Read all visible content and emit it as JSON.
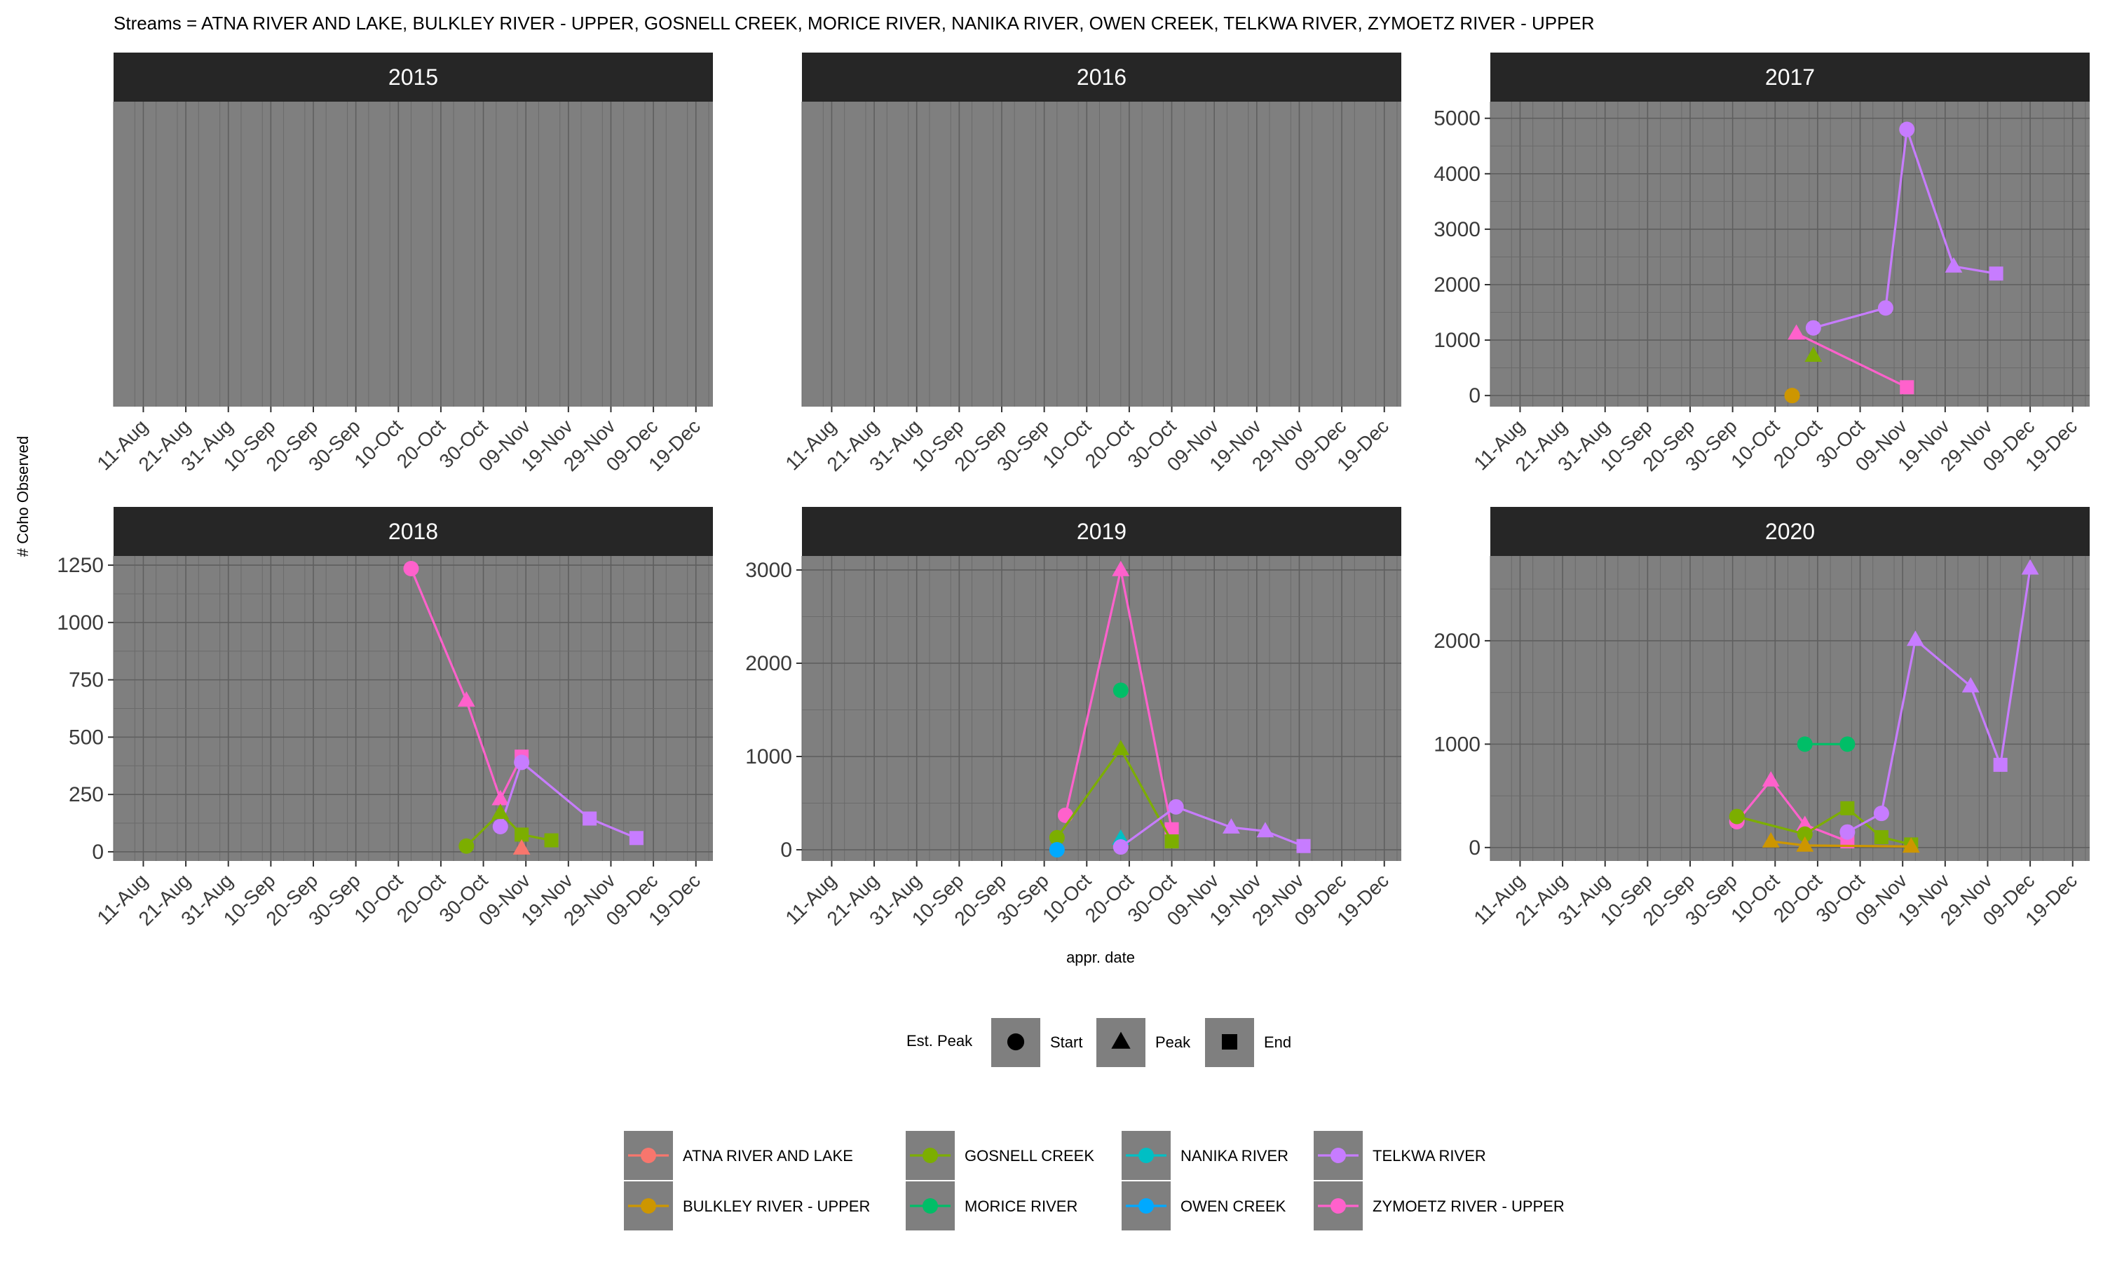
{
  "header": "Streams = ATNA RIVER AND LAKE, BULKLEY RIVER - UPPER, GOSNELL CREEK, MORICE RIVER, NANIKA RIVER, OWEN CREEK, TELKWA RIVER, ZYMOETZ RIVER - UPPER",
  "colors": {
    "ATNA RIVER AND LAKE": "#F8766D",
    "BULKLEY RIVER - UPPER": "#CD9600",
    "GOSNELL CREEK": "#7CAE00",
    "MORICE RIVER": "#00BE67",
    "NANIKA RIVER": "#00BFC4",
    "OWEN CREEK": "#00A9FF",
    "TELKWA RIVER": "#C77CFF",
    "ZYMOETZ RIVER - UPPER": "#FF61CC",
    "panel_bg": "#7F7F7F",
    "strip_bg": "#262626"
  },
  "chart_data": {
    "type": "scatter",
    "ylabel": "# Coho Observed",
    "xlabel": "appr. date",
    "x_ticks": [
      "11-Aug",
      "21-Aug",
      "31-Aug",
      "10-Sep",
      "20-Sep",
      "30-Sep",
      "10-Oct",
      "20-Oct",
      "30-Oct",
      "09-Nov",
      "19-Nov",
      "29-Nov",
      "09-Dec",
      "19-Dec"
    ],
    "xlim": [
      "04-Aug",
      "23-Dec"
    ],
    "legend_shape": {
      "title": "Est. Peak",
      "items": [
        "Start",
        "Peak",
        "End"
      ]
    },
    "legend_color": {
      "items": [
        "ATNA RIVER AND LAKE",
        "BULKLEY RIVER - UPPER",
        "GOSNELL CREEK",
        "MORICE RIVER",
        "NANIKA RIVER",
        "OWEN CREEK",
        "TELKWA RIVER",
        "ZYMOETZ RIVER - UPPER"
      ]
    },
    "panels": [
      {
        "title": "2015",
        "ylim": null,
        "yticks": [],
        "series": []
      },
      {
        "title": "2016",
        "ylim": null,
        "yticks": [],
        "series": []
      },
      {
        "title": "2017",
        "ylim": [
          -200,
          5300
        ],
        "yticks": [
          0,
          1000,
          2000,
          3000,
          4000,
          5000
        ],
        "series": [
          {
            "name": "TELKWA RIVER",
            "points": [
              [
                "19-Oct",
                1220,
                "Start"
              ],
              [
                "05-Nov",
                1580,
                "Start"
              ],
              [
                "10-Nov",
                4800,
                "Start"
              ],
              [
                "21-Nov",
                2330,
                "Peak"
              ],
              [
                "01-Dec",
                2200,
                "End"
              ]
            ]
          },
          {
            "name": "ZYMOETZ RIVER - UPPER",
            "points": [
              [
                "15-Oct",
                1120,
                "Peak"
              ],
              [
                "10-Nov",
                150,
                "End"
              ]
            ]
          },
          {
            "name": "GOSNELL CREEK",
            "points": [
              [
                "19-Oct",
                720,
                "Peak"
              ]
            ]
          },
          {
            "name": "BULKLEY RIVER - UPPER",
            "points": [
              [
                "14-Oct",
                0,
                "Start"
              ]
            ]
          }
        ]
      },
      {
        "title": "2018",
        "ylim": [
          -40,
          1290
        ],
        "yticks": [
          0,
          250,
          500,
          750,
          1000,
          1250
        ],
        "series": [
          {
            "name": "ZYMOETZ RIVER - UPPER",
            "points": [
              [
                "13-Oct",
                1235,
                "Start"
              ],
              [
                "26-Oct",
                660,
                "Peak"
              ],
              [
                "03-Nov",
                230,
                "Peak"
              ],
              [
                "08-Nov",
                415,
                "End"
              ]
            ]
          },
          {
            "name": "TELKWA RIVER",
            "points": [
              [
                "03-Nov",
                110,
                "Start"
              ],
              [
                "08-Nov",
                390,
                "Start"
              ],
              [
                "24-Nov",
                145,
                "End"
              ],
              [
                "05-Dec",
                60,
                "End"
              ]
            ]
          },
          {
            "name": "GOSNELL CREEK",
            "points": [
              [
                "26-Oct",
                25,
                "Start"
              ],
              [
                "03-Nov",
                170,
                "Peak"
              ],
              [
                "08-Nov",
                75,
                "End"
              ],
              [
                "15-Nov",
                50,
                "End"
              ]
            ]
          },
          {
            "name": "ATNA RIVER AND LAKE",
            "points": [
              [
                "08-Nov",
                15,
                "Peak"
              ]
            ]
          }
        ]
      },
      {
        "title": "2019",
        "ylim": [
          -120,
          3150
        ],
        "yticks": [
          0,
          1000,
          2000,
          3000
        ],
        "series": [
          {
            "name": "ZYMOETZ RIVER - UPPER",
            "points": [
              [
                "05-Oct",
                370,
                "Start"
              ],
              [
                "18-Oct",
                3000,
                "Peak"
              ],
              [
                "30-Oct",
                220,
                "End"
              ]
            ]
          },
          {
            "name": "GOSNELL CREEK",
            "points": [
              [
                "03-Oct",
                130,
                "Start"
              ],
              [
                "18-Oct",
                1080,
                "Peak"
              ],
              [
                "30-Oct",
                90,
                "End"
              ]
            ]
          },
          {
            "name": "MORICE RIVER",
            "points": [
              [
                "18-Oct",
                1710,
                "Start"
              ]
            ]
          },
          {
            "name": "NANIKA RIVER",
            "points": [
              [
                "18-Oct",
                120,
                "Peak"
              ]
            ]
          },
          {
            "name": "OWEN CREEK",
            "points": [
              [
                "03-Oct",
                0,
                "Start"
              ]
            ]
          },
          {
            "name": "TELKWA RIVER",
            "points": [
              [
                "18-Oct",
                30,
                "Start"
              ],
              [
                "31-Oct",
                460,
                "Start"
              ],
              [
                "13-Nov",
                240,
                "Peak"
              ],
              [
                "21-Nov",
                200,
                "Peak"
              ],
              [
                "30-Nov",
                40,
                "End"
              ]
            ]
          }
        ]
      },
      {
        "title": "2020",
        "ylim": [
          -130,
          2820
        ],
        "yticks": [
          0,
          1000,
          2000
        ],
        "series": [
          {
            "name": "ZYMOETZ RIVER - UPPER",
            "points": [
              [
                "01-Oct",
                250,
                "Start"
              ],
              [
                "09-Oct",
                650,
                "Peak"
              ],
              [
                "17-Oct",
                220,
                "Peak"
              ],
              [
                "27-Oct",
                60,
                "End"
              ]
            ]
          },
          {
            "name": "GOSNELL CREEK",
            "points": [
              [
                "01-Oct",
                300,
                "Start"
              ],
              [
                "17-Oct",
                130,
                "Start"
              ],
              [
                "27-Oct",
                380,
                "End"
              ],
              [
                "04-Nov",
                100,
                "End"
              ],
              [
                "11-Nov",
                30,
                "End"
              ]
            ]
          },
          {
            "name": "MORICE RIVER",
            "points": [
              [
                "17-Oct",
                1000,
                "Start"
              ],
              [
                "27-Oct",
                1000,
                "Start"
              ]
            ]
          },
          {
            "name": "BULKLEY RIVER - UPPER",
            "points": [
              [
                "09-Oct",
                60,
                "Peak"
              ],
              [
                "17-Oct",
                20,
                "Peak"
              ],
              [
                "11-Nov",
                10,
                "Peak"
              ]
            ]
          },
          {
            "name": "TELKWA RIVER",
            "points": [
              [
                "27-Oct",
                150,
                "Start"
              ],
              [
                "04-Nov",
                330,
                "Start"
              ],
              [
                "12-Nov",
                2010,
                "Peak"
              ],
              [
                "25-Nov",
                1560,
                "Peak"
              ],
              [
                "02-Dec",
                800,
                "End"
              ],
              [
                "09-Dec",
                2700,
                "Peak"
              ]
            ]
          }
        ]
      }
    ]
  }
}
